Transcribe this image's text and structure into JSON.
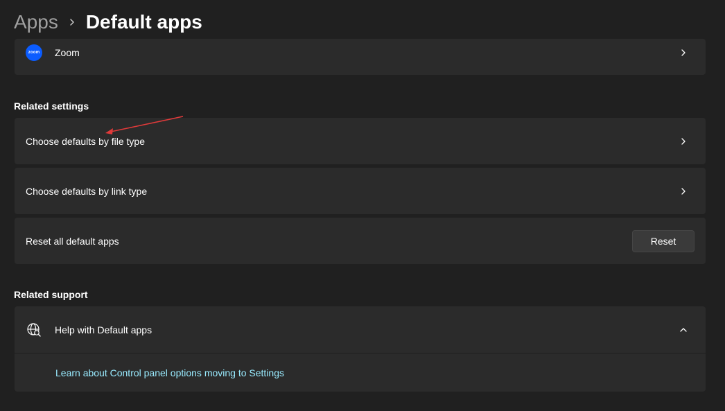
{
  "breadcrumb": {
    "parent": "Apps",
    "current": "Default apps"
  },
  "zoom_row": {
    "logo_text": "zoom",
    "label": "Zoom"
  },
  "related_settings": {
    "title": "Related settings",
    "items": [
      {
        "label": "Choose defaults by file type"
      },
      {
        "label": "Choose defaults by link type"
      }
    ],
    "reset": {
      "label": "Reset all default apps",
      "button": "Reset"
    }
  },
  "related_support": {
    "title": "Related support",
    "help_title": "Help with Default apps",
    "link": "Learn about Control panel options moving to Settings"
  },
  "colors": {
    "background": "#202020",
    "card": "#2b2b2b",
    "link": "#99ebff",
    "zoom_blue": "#0b5cff",
    "annotation": "#e03a3a"
  }
}
